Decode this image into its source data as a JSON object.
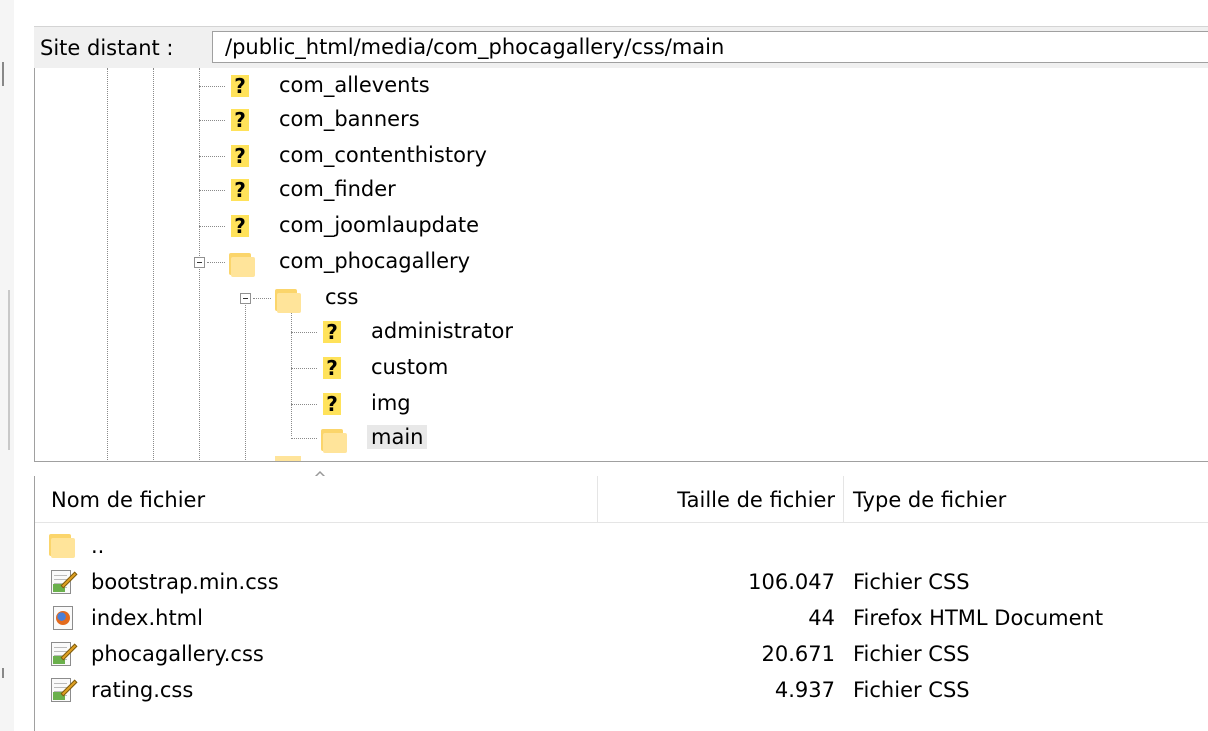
{
  "pathbar": {
    "label": "Site distant :",
    "path": "/public_html/media/com_phocagallery/css/main"
  },
  "tree": {
    "items": [
      {
        "label": "com_allevents",
        "icon": "folder-unknown-icon"
      },
      {
        "label": "com_banners",
        "icon": "folder-unknown-icon"
      },
      {
        "label": "com_contenthistory",
        "icon": "folder-unknown-icon"
      },
      {
        "label": "com_finder",
        "icon": "folder-unknown-icon"
      },
      {
        "label": "com_joomlaupdate",
        "icon": "folder-unknown-icon"
      },
      {
        "label": "com_phocagallery",
        "icon": "folder-icon",
        "expanded": true
      },
      {
        "label": "css",
        "icon": "folder-icon",
        "expanded": true
      },
      {
        "label": "administrator",
        "icon": "folder-unknown-icon"
      },
      {
        "label": "custom",
        "icon": "folder-unknown-icon"
      },
      {
        "label": "img",
        "icon": "folder-unknown-icon"
      },
      {
        "label": "main",
        "icon": "folder-icon",
        "selected": true
      }
    ]
  },
  "list": {
    "headers": {
      "name": "Nom de fichier",
      "size": "Taille de fichier",
      "type": "Type de fichier"
    },
    "rows": [
      {
        "name": "..",
        "size": "",
        "type": "",
        "icon": "folder-icon"
      },
      {
        "name": "bootstrap.min.css",
        "size": "106.047",
        "type": "Fichier CSS",
        "icon": "css-file-icon"
      },
      {
        "name": "index.html",
        "size": "44",
        "type": "Firefox HTML Document",
        "icon": "firefox-html-icon"
      },
      {
        "name": "phocagallery.css",
        "size": "20.671",
        "type": "Fichier CSS",
        "icon": "css-file-icon"
      },
      {
        "name": "rating.css",
        "size": "4.937",
        "type": "Fichier CSS",
        "icon": "css-file-icon"
      }
    ]
  }
}
